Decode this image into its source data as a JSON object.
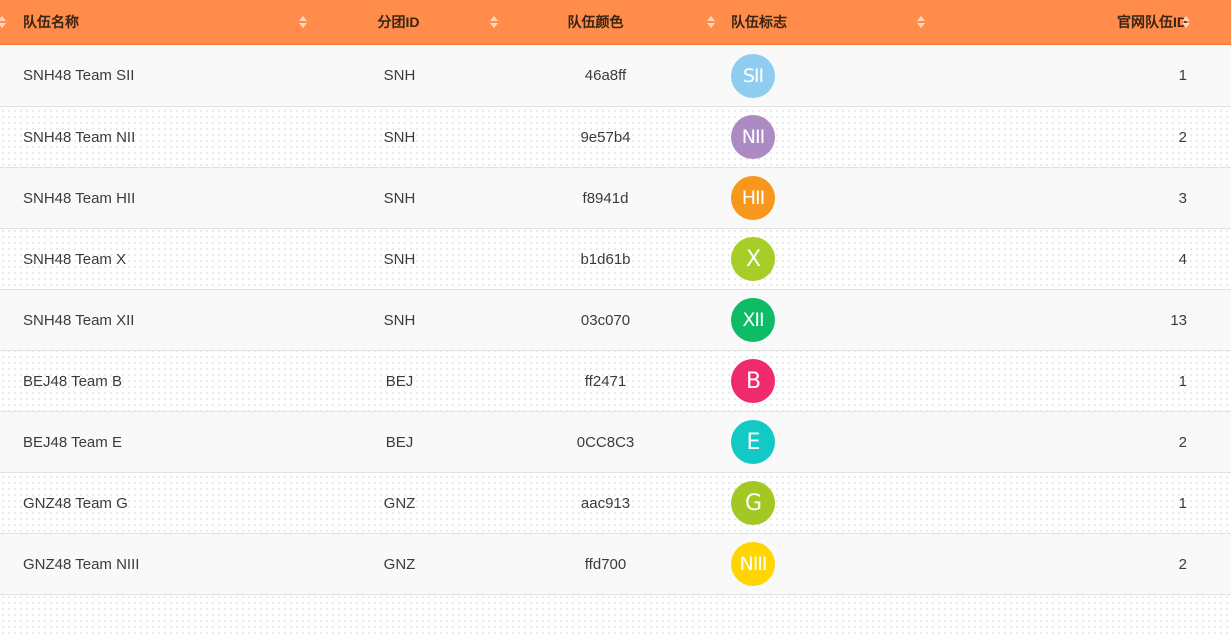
{
  "columns": [
    {
      "key": "name",
      "label": "队伍名称"
    },
    {
      "key": "group",
      "label": "分团ID"
    },
    {
      "key": "color",
      "label": "队伍颜色"
    },
    {
      "key": "logo",
      "label": "队伍标志"
    },
    {
      "key": "team_id",
      "label": "官网队伍ID"
    }
  ],
  "rows": [
    {
      "name": "SNH48 Team SII",
      "group": "SNH",
      "color": "46a8ff",
      "logo_text": "SII",
      "logo_color": "#8fcdf0",
      "team_id": "1"
    },
    {
      "name": "SNH48 Team NII",
      "group": "SNH",
      "color": "9e57b4",
      "logo_text": "NII",
      "logo_color": "#ac8bc3",
      "team_id": "2"
    },
    {
      "name": "SNH48 Team HII",
      "group": "SNH",
      "color": "f8941d",
      "logo_text": "HII",
      "logo_color": "#f7981d",
      "team_id": "3"
    },
    {
      "name": "SNH48 Team X",
      "group": "SNH",
      "color": "b1d61b",
      "logo_text": "X",
      "logo_color": "#a7cd28",
      "team_id": "4"
    },
    {
      "name": "SNH48 Team XII",
      "group": "SNH",
      "color": "03c070",
      "logo_text": "XII",
      "logo_color": "#0dbc64",
      "team_id": "13"
    },
    {
      "name": "BEJ48 Team B",
      "group": "BEJ",
      "color": "ff2471",
      "logo_text": "B",
      "logo_color": "#ef2a6f",
      "team_id": "1"
    },
    {
      "name": "BEJ48 Team E",
      "group": "BEJ",
      "color": "0CC8C3",
      "logo_text": "E",
      "logo_color": "#12c9c5",
      "team_id": "2"
    },
    {
      "name": "GNZ48 Team G",
      "group": "GNZ",
      "color": "aac913",
      "logo_text": "G",
      "logo_color": "#a4c823",
      "team_id": "1"
    },
    {
      "name": "GNZ48 Team NIII",
      "group": "GNZ",
      "color": "ffd700",
      "logo_text": "NIII",
      "logo_color": "#ffd600",
      "team_id": "2"
    }
  ],
  "theme": {
    "header_bg": "#ff8c4a",
    "header_text": "#3a2414",
    "row_alt_bg": "#f9f9f9",
    "row_border": "#e2e2e2"
  },
  "icons": {
    "sort": "sort-arrows-icon"
  }
}
